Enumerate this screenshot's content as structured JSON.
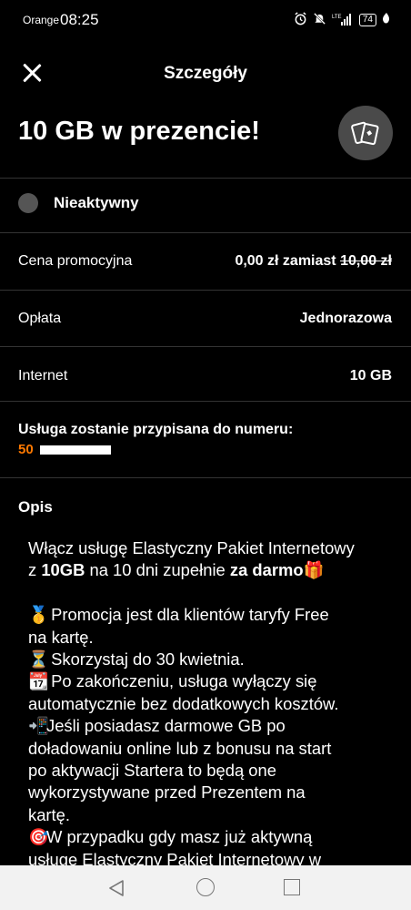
{
  "status_bar": {
    "carrier": "Orange",
    "time": "08:25",
    "battery": "74",
    "network": "LTE",
    "icons": [
      "alarm-icon",
      "mute-icon",
      "signal-icon",
      "battery-icon",
      "leaf-icon"
    ]
  },
  "header": {
    "title": "Szczegóły",
    "close_icon": "close-icon"
  },
  "offer": {
    "title": "10 GB w prezencie!",
    "badge_icon": "gift-cards-icon"
  },
  "state": {
    "label": "Nieaktywny"
  },
  "details": {
    "price_label": "Cena promocyjna",
    "price_new": "0,00 zł zamiast ",
    "price_old": "10,00 zł",
    "fee_label": "Opłata",
    "fee_value": "Jednorazowa",
    "internet_label": "Internet",
    "internet_value": "10 GB"
  },
  "assignment": {
    "label": "Usługa zostanie przypisana do numeru:",
    "number_prefix": "50"
  },
  "description": {
    "title": "Opis",
    "l1": "Włącz usługę Elastyczny Pakiet Internetowy",
    "l2_a": "z ",
    "l2_b": "10GB",
    "l2_c": " na 10 dni zupełnie ",
    "l2_d": "za darmo",
    "l2_e": "🎁",
    "l3_emoji": "🥇",
    "l3": " Promocja jest dla klientów taryfy Free",
    "l4": "na kartę.",
    "l5_emoji": "⏳",
    "l5": " Skorzystaj do 30 kwietnia.",
    "l6_emoji": "📆",
    "l6": " Po zakończeniu, usługa wyłączy się",
    "l7": "automatycznie bez dodatkowych kosztów.",
    "l8_emoji": "📲",
    "l8": "Jeśli posiadasz darmowe GB po",
    "l9": "doładowaniu online lub z bonusu na start",
    "l10": "po aktywacji Startera to będą one",
    "l11": "wykorzystywane przed  Prezentem na",
    "l12": "kartę.",
    "l13_emoji": "🎯",
    "l13": "W przypadku gdy masz już aktywną",
    "l14": "usługę Elastyczny Pakiet Internetowy w"
  },
  "nav": {
    "icons": [
      "back-icon",
      "home-icon",
      "recents-icon"
    ]
  },
  "colors": {
    "background": "#000000",
    "accent": "#ff7900",
    "divider": "#333333",
    "navbar": "#f2f2f2"
  }
}
